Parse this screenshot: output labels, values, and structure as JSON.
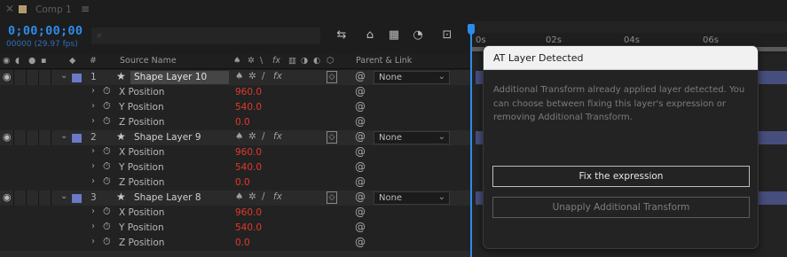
{
  "tab": {
    "close_glyph": "✕",
    "title": "Comp 1",
    "menu_glyph": "≡"
  },
  "time": {
    "timecode": "0;00;00;00",
    "frames_fps": "00000 (29.97 fps)"
  },
  "search": {
    "placeholder": ""
  },
  "toolbar_icons": [
    "composition-flowchart-icon",
    "draft-3d-icon",
    "frame-blending-icon",
    "motion-blur-icon",
    "graph-editor-icon"
  ],
  "columns": {
    "source_name": "Source Name",
    "hash": "#",
    "parent_link": "Parent & Link"
  },
  "layers": [
    {
      "number": "1",
      "name": "Shape Layer 10",
      "selected": true,
      "parent": "None",
      "props": [
        {
          "name": "X Position",
          "value": "960.0"
        },
        {
          "name": "Y Position",
          "value": "540.0"
        },
        {
          "name": "Z Position",
          "value": "0.0"
        }
      ]
    },
    {
      "number": "2",
      "name": "Shape Layer 9",
      "selected": false,
      "parent": "None",
      "props": [
        {
          "name": "X Position",
          "value": "960.0"
        },
        {
          "name": "Y Position",
          "value": "540.0"
        },
        {
          "name": "Z Position",
          "value": "0.0"
        }
      ]
    },
    {
      "number": "3",
      "name": "Shape Layer 8",
      "selected": false,
      "parent": "None",
      "props": [
        {
          "name": "X Position",
          "value": "960.0"
        },
        {
          "name": "Y Position",
          "value": "540.0"
        },
        {
          "name": "Z Position",
          "value": "0.0"
        }
      ]
    }
  ],
  "ruler": {
    "ticks": [
      "0s",
      "02s",
      "04s",
      "06s"
    ]
  },
  "dialog": {
    "title": "AT Layer Detected",
    "message": "Additional Transform already applied layer detected. You can choose between fixing this layer's expression or removing Additional Transform.",
    "primary_button": "Fix the expression",
    "secondary_button": "Unapply Additional Transform"
  },
  "colors": {
    "timecode": "#2d8ceb",
    "label": "#6b79c7",
    "keyframe_value": "#e03a2a",
    "dialog_header": "#f1f1f1"
  }
}
